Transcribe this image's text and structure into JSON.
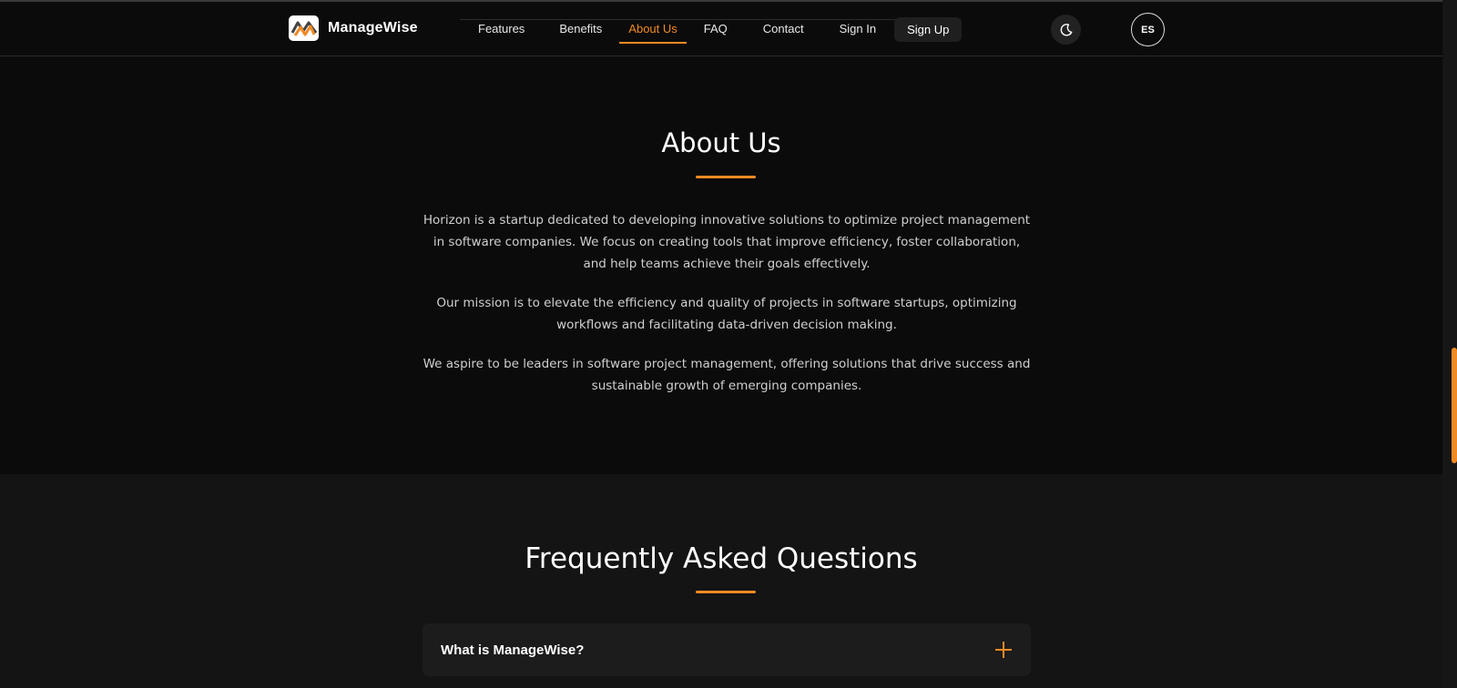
{
  "header": {
    "brand_name": "ManageWise",
    "nav": [
      {
        "label": "Features",
        "active": false
      },
      {
        "label": "Benefits",
        "active": false
      },
      {
        "label": "About Us",
        "active": true
      },
      {
        "label": "FAQ",
        "active": false
      },
      {
        "label": "Contact",
        "active": false
      },
      {
        "label": "Sign In",
        "active": false
      }
    ],
    "signup_label": "Sign Up",
    "theme_icon": "moon-icon",
    "lang_label": "ES"
  },
  "about": {
    "title": "About Us",
    "paragraphs": [
      "Horizon is a startup dedicated to developing innovative solutions to optimize project management in software companies. We focus on creating tools that improve efficiency, foster collaboration, and help teams achieve their goals effectively.",
      "Our mission is to elevate the efficiency and quality of projects in software startups, optimizing workflows and facilitating data-driven decision making.",
      "We aspire to be leaders in software project management, offering solutions that drive success and sustainable growth of emerging companies."
    ]
  },
  "faq": {
    "title": "Frequently Asked Questions",
    "items": [
      {
        "question": "What is ManageWise?",
        "icon": "plus-icon"
      }
    ]
  },
  "colors": {
    "accent": "#f08a24",
    "background": "#0b0b0b",
    "faq_background": "#141414",
    "card": "#1c1c1c"
  }
}
